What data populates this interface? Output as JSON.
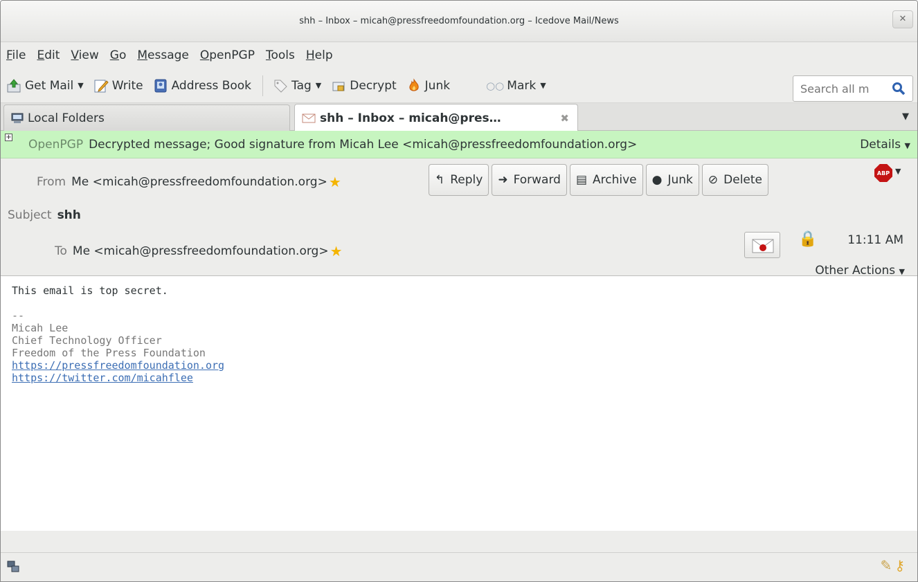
{
  "window": {
    "title": "shh – Inbox – micah@pressfreedomfoundation.org – Icedove Mail/News",
    "close_label": "✕"
  },
  "menubar": {
    "items": [
      {
        "key": "F",
        "rest": "ile"
      },
      {
        "key": "E",
        "rest": "dit"
      },
      {
        "key": "V",
        "rest": "iew"
      },
      {
        "key": "G",
        "rest": "o"
      },
      {
        "key": "M",
        "rest": "essage"
      },
      {
        "key": "O",
        "rest": "penPGP"
      },
      {
        "key": "T",
        "rest": "ools"
      },
      {
        "key": "H",
        "rest": "elp"
      }
    ]
  },
  "toolbar": {
    "get_mail": "Get Mail",
    "write": "Write",
    "address_book": "Address Book",
    "tag": "Tag",
    "decrypt": "Decrypt",
    "junk": "Junk",
    "mark": "Mark",
    "search_placeholder": "Search all m"
  },
  "tabs": {
    "local_folders": "Local Folders",
    "active": "shh – Inbox – micah@pres…"
  },
  "pgp": {
    "label": "OpenPGP",
    "status": "Decrypted message; Good signature from Micah Lee <micah@pressfreedomfoundation.org>",
    "details": "Details"
  },
  "header": {
    "from_label": "From",
    "from_value": "Me <micah@pressfreedomfoundation.org>",
    "subject_label": "Subject",
    "subject_value": "shh",
    "to_label": "To",
    "to_value": "Me <micah@pressfreedomfoundation.org>",
    "time": "11:11 AM",
    "other_actions": "Other Actions",
    "buttons": {
      "reply": "Reply",
      "forward": "Forward",
      "archive": "Archive",
      "junk": "Junk",
      "delete": "Delete"
    },
    "abp": "ABP"
  },
  "body": {
    "text": "This email is top secret.",
    "sig_sep": "--",
    "sig_name": "Micah Lee",
    "sig_title": "Chief Technology Officer",
    "sig_org": "Freedom of the Press Foundation",
    "link1": "https://pressfreedomfoundation.org",
    "link2": "https://twitter.com/micahflee"
  },
  "icons": [
    "get-mail-icon",
    "write-icon",
    "address-book-icon",
    "tag-icon",
    "decrypt-icon",
    "junk-flame-icon",
    "mark-glasses-icon",
    "search-icon",
    "local-folders-icon",
    "envelope-tab-icon",
    "star-icon",
    "reply-icon",
    "forward-icon",
    "archive-icon",
    "junk-icon",
    "delete-icon",
    "adblock-icon",
    "sealed-envelope-icon",
    "lock-icon",
    "network-icon",
    "pencil-icon",
    "key-icon"
  ]
}
